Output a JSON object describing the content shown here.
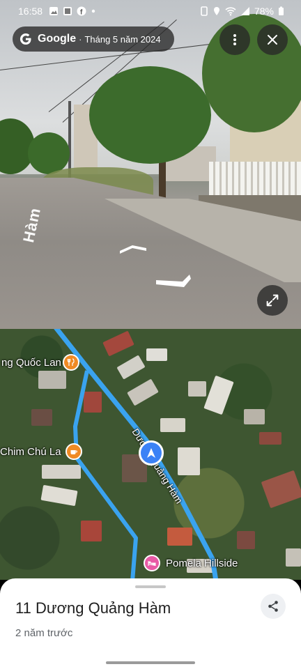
{
  "status_bar": {
    "time": "16:58",
    "battery": "78%"
  },
  "top_bar": {
    "brand": "Google",
    "separator": "·",
    "date": "Tháng 5 năm 2024"
  },
  "street_view": {
    "road_text": "Hàm"
  },
  "map": {
    "labels": {
      "poi_1": "ng Quốc Lan",
      "poi_2": "Chim Chú La",
      "street": "Dương Quảng Hàm",
      "poi_3": "Pomela Hillside"
    },
    "colors": {
      "route": "#3aa3ef",
      "restaurant": "#f08a24",
      "cafe": "#f08a24",
      "hotel": "#e85aa6",
      "pin": "#3b82f6"
    }
  },
  "sheet": {
    "title": "11 Dương Quảng Hàm",
    "subtitle": "2 năm trước"
  },
  "icons": {
    "menu": "more-vert-icon",
    "close": "close-icon",
    "expand": "expand-icon",
    "share": "share-icon"
  }
}
